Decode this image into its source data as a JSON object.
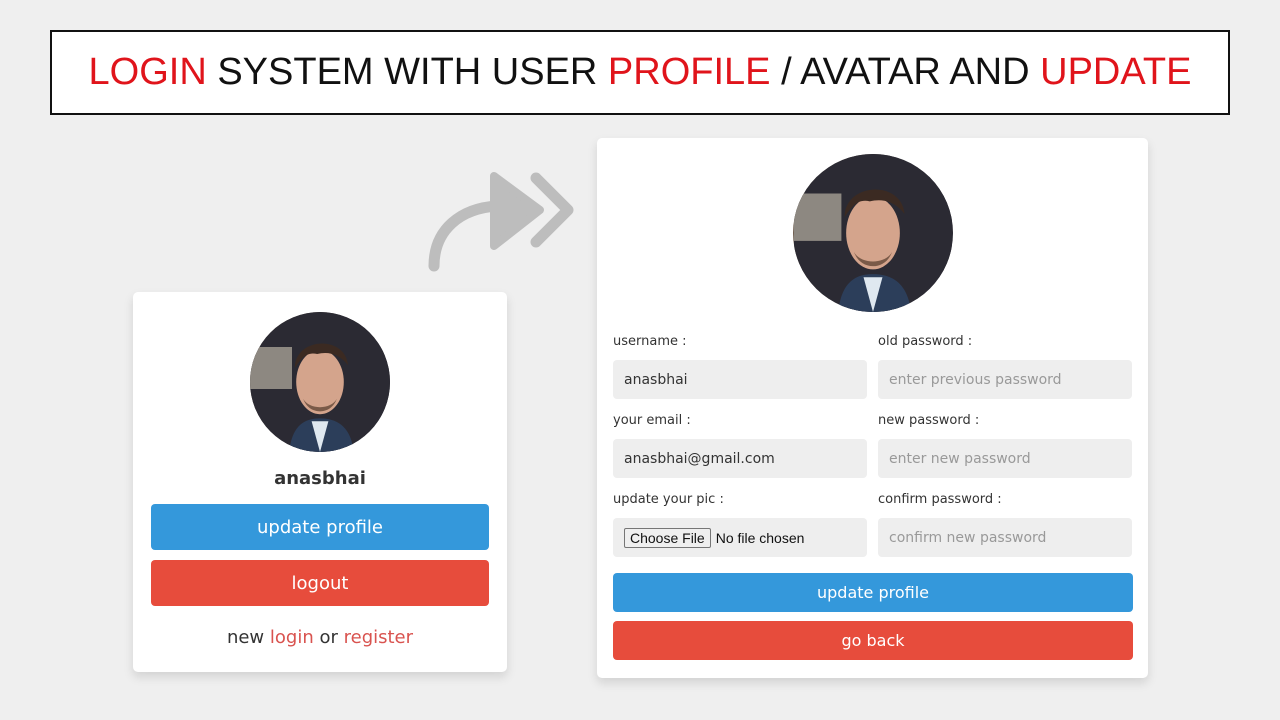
{
  "banner": {
    "parts": [
      {
        "text": "LOGIN",
        "highlight": true
      },
      {
        "text": " SYSTEM WITH USER ",
        "highlight": false
      },
      {
        "text": "PROFILE",
        "highlight": true
      },
      {
        "text": " / AVATAR AND ",
        "highlight": false
      },
      {
        "text": "UPDATE",
        "highlight": true
      }
    ],
    "highlight_color": "#e0141b"
  },
  "icons": {
    "transition_arrow": "curved-arrow-with-double-chevron-icon"
  },
  "profile_card": {
    "avatar_alt": "user avatar",
    "username": "anasbhai",
    "update_button": "update profile",
    "logout_button": "logout",
    "footer": {
      "prefix": "new ",
      "login_link": "login",
      "middle": " or ",
      "register_link": "register"
    }
  },
  "update_card": {
    "avatar_alt": "user avatar",
    "fields": {
      "username": {
        "label": "username :",
        "value": "anasbhai"
      },
      "email": {
        "label": "your email :",
        "value": "anasbhai@gmail.com"
      },
      "pic": {
        "label": "update your pic :",
        "button": "Choose File",
        "status": "No file chosen"
      },
      "old_password": {
        "label": "old password :",
        "placeholder": "enter previous password"
      },
      "new_password": {
        "label": "new password :",
        "placeholder": "enter new password"
      },
      "confirm_password": {
        "label": "confirm password :",
        "placeholder": "confirm new password"
      }
    },
    "update_button": "update profile",
    "back_button": "go back"
  },
  "colors": {
    "primary": "#3498db",
    "danger": "#e74c3c",
    "link": "#d9534f",
    "background": "#efefef"
  }
}
